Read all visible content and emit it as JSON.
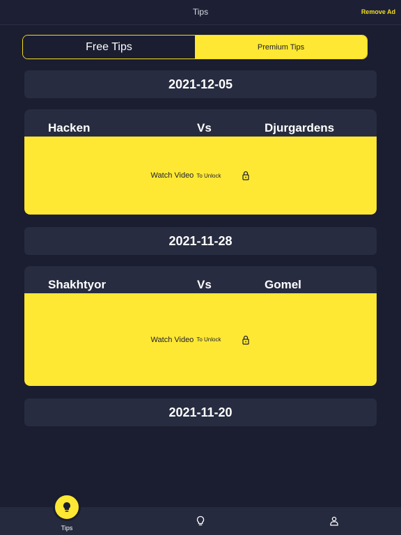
{
  "header": {
    "title": "Tips",
    "remove_ad": "Remove Ad"
  },
  "tabs": {
    "free": "Free Tips",
    "premium": "Premium Tips"
  },
  "sections": [
    {
      "date": "2021-12-05"
    },
    {
      "date": "2021-11-28"
    },
    {
      "date": "2021-11-20"
    }
  ],
  "matches": [
    {
      "home": "Hacken",
      "vs": "Vs",
      "away": "Djurgardens",
      "watch": "Watch Video",
      "unlock": "To Unlock"
    },
    {
      "home": "Shakhtyor",
      "vs": "Vs",
      "away": "Gomel",
      "watch": "Watch Video",
      "unlock": "To Unlock"
    }
  ],
  "nav": {
    "tips": "Tips"
  },
  "colors": {
    "accent": "#ffe833",
    "background": "#1b1d30",
    "card": "#272c40"
  },
  "icons": [
    "lock-icon",
    "lightbulb-icon",
    "user-icon"
  ]
}
